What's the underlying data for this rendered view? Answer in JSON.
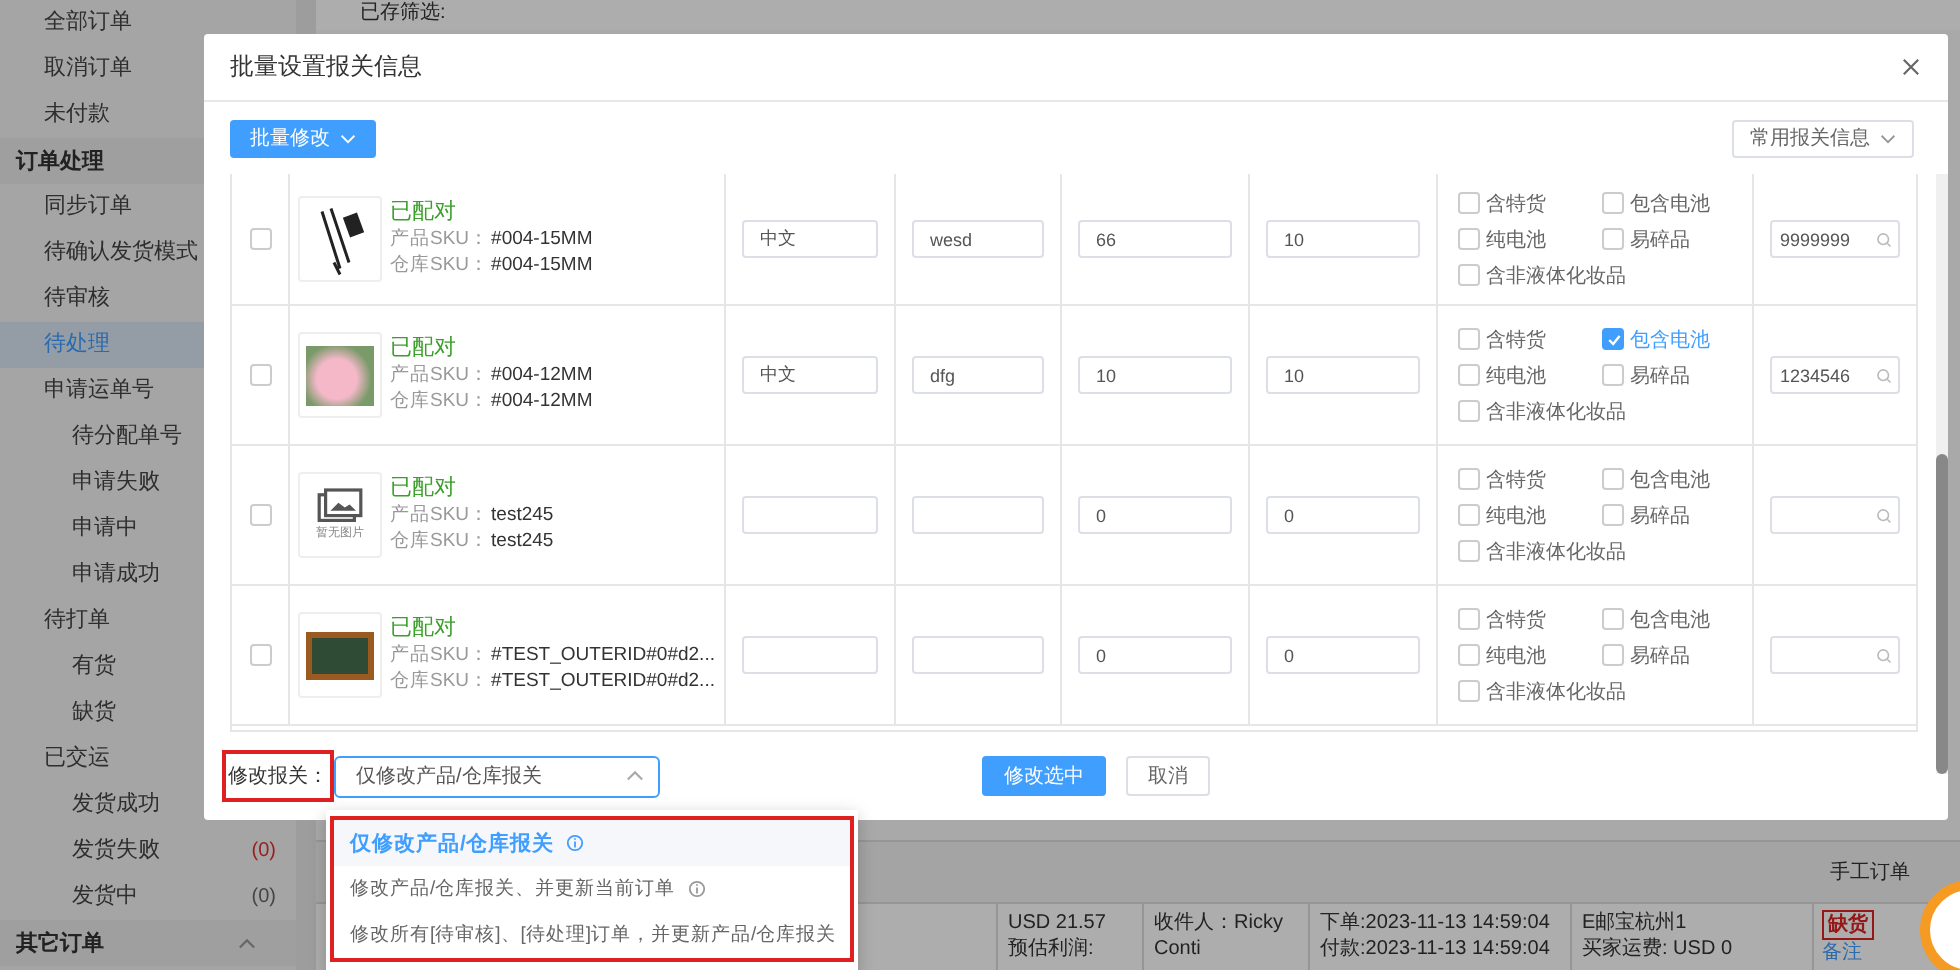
{
  "sidebar": {
    "top_items": [
      {
        "label": "全部订单",
        "selected": false
      },
      {
        "label": "取消订单",
        "selected": false
      },
      {
        "label": "未付款",
        "selected": false
      }
    ],
    "sections": [
      {
        "title": "订单处理",
        "expanded": true,
        "items": [
          {
            "label": "同步订单",
            "selected": false
          },
          {
            "label": "待确认发货模式",
            "selected": false
          },
          {
            "label": "待审核",
            "selected": false
          },
          {
            "label": "待处理",
            "selected": true
          },
          {
            "label": "申请运单号",
            "selected": false,
            "children": [
              {
                "label": "待分配单号",
                "selected": false
              },
              {
                "label": "申请失败",
                "selected": false
              },
              {
                "label": "申请中",
                "selected": false
              },
              {
                "label": "申请成功",
                "selected": false
              }
            ]
          },
          {
            "label": "待打单",
            "selected": false,
            "children": [
              {
                "label": "有货",
                "selected": false
              },
              {
                "label": "缺货",
                "selected": false
              }
            ]
          },
          {
            "label": "已交运",
            "selected": false,
            "children": [
              {
                "label": "发货成功",
                "selected": false
              },
              {
                "label": "发货失败",
                "selected": false,
                "count": "(0)",
                "alert": true
              },
              {
                "label": "发货中",
                "selected": false,
                "count": "(0)",
                "alert": false
              }
            ]
          }
        ]
      },
      {
        "title": "其它订单",
        "expanded": true
      }
    ]
  },
  "filter_bar": {
    "label": "已存筛选:"
  },
  "order": {
    "tag": "手工订单",
    "amount": "USD 21.57",
    "profit_label": "预估利润:",
    "recipient": "收件人：Ricky Conti",
    "ordered": "下单:2023-11-13 14:59:04",
    "paid": "付款:2023-11-13 14:59:04",
    "warehouse": "E邮宝杭州1",
    "shipping": "买家运费:  USD 0",
    "stock_stamp": "缺货",
    "note_link": "备注"
  },
  "dialog": {
    "title": "批量设置报关信息",
    "batch_button": "批量修改",
    "presets_button": "常用报关信息",
    "rows": [
      {
        "checked": false,
        "image": {
          "kind": "cable"
        },
        "status": "已配对",
        "product_sku_label": "产品SKU：",
        "product_sku": "#004-15MM",
        "warehouse_sku_label": "仓库SKU：",
        "warehouse_sku": "#004-15MM",
        "inputs": {
          "column_3": "中文",
          "column_4": "wesd",
          "column_5": "66",
          "column_6": "10"
        },
        "code": "9999999",
        "flags": [
          {
            "label": "含特货",
            "checked": false
          },
          {
            "label": "包含电池",
            "checked": false
          },
          {
            "label": "纯电池",
            "checked": false
          },
          {
            "label": "易碎品",
            "checked": false
          },
          {
            "label": "含非液体化妆品",
            "checked": false
          }
        ]
      },
      {
        "checked": false,
        "image": {
          "kind": "pink"
        },
        "status": "已配对",
        "product_sku_label": "产品SKU：",
        "product_sku": "#004-12MM",
        "warehouse_sku_label": "仓库SKU：",
        "warehouse_sku": "#004-12MM",
        "inputs": {
          "column_3": "中文",
          "column_4": "dfg",
          "column_5": "10",
          "column_6": "10"
        },
        "code": "1234546",
        "flags": [
          {
            "label": "含特货",
            "checked": false
          },
          {
            "label": "包含电池",
            "checked": true
          },
          {
            "label": "纯电池",
            "checked": false
          },
          {
            "label": "易碎品",
            "checked": false
          },
          {
            "label": "含非液体化妆品",
            "checked": false
          }
        ]
      },
      {
        "checked": false,
        "image": {
          "kind": "none",
          "label": "暂无图片"
        },
        "status": "已配对",
        "product_sku_label": "产品SKU：",
        "product_sku": "test245",
        "warehouse_sku_label": "仓库SKU：",
        "warehouse_sku": "test245",
        "inputs": {
          "column_5": "0",
          "column_6": "0"
        },
        "flags": [
          {
            "label": "含特货",
            "checked": false
          },
          {
            "label": "包含电池",
            "checked": false
          },
          {
            "label": "纯电池",
            "checked": false
          },
          {
            "label": "易碎品",
            "checked": false
          },
          {
            "label": "含非液体化妆品",
            "checked": false
          }
        ]
      },
      {
        "checked": false,
        "image": {
          "kind": "board"
        },
        "status": "已配对",
        "product_sku_label": "产品SKU：",
        "product_sku": "#TEST_OUTERID#0#d2...",
        "warehouse_sku_label": "仓库SKU：",
        "warehouse_sku": "#TEST_OUTERID#0#d2...",
        "inputs": {
          "column_5": "0",
          "column_6": "0"
        },
        "flags": [
          {
            "label": "含特货",
            "checked": false
          },
          {
            "label": "包含电池",
            "checked": false
          },
          {
            "label": "纯电池",
            "checked": false
          },
          {
            "label": "易碎品",
            "checked": false
          },
          {
            "label": "含非液体化妆品",
            "checked": false
          }
        ]
      }
    ],
    "footer": {
      "label": "修改报关：",
      "highlighted": true,
      "select_value": "仅修改产品/仓库报关",
      "open": true,
      "confirm": "修改选中",
      "cancel": "取消"
    }
  },
  "dropdown": {
    "highlighted": true,
    "options": [
      {
        "label": "仅修改产品/仓库报关",
        "selected": true,
        "info": true
      },
      {
        "label": "修改产品/仓库报关、并更新当前订单",
        "selected": false,
        "info": true
      },
      {
        "label": "修改所有[待审核]、[待处理]订单，并更新产品/仓库报关",
        "selected": false,
        "info": false
      }
    ]
  }
}
